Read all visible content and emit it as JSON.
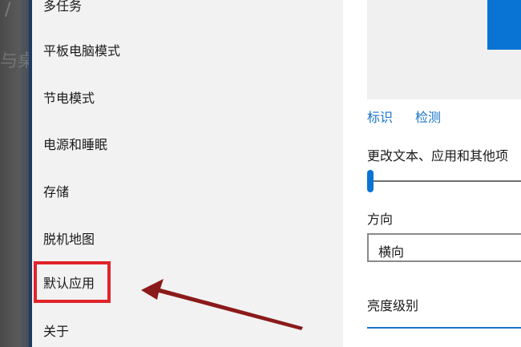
{
  "background": {
    "ghost_text": "与桌",
    "ghost_slash": "/"
  },
  "sidebar": {
    "items": [
      {
        "label": "多任务"
      },
      {
        "label": "平板电脑模式"
      },
      {
        "label": "节电模式"
      },
      {
        "label": "电源和睡眠"
      },
      {
        "label": "存储"
      },
      {
        "label": "脱机地图"
      },
      {
        "label": "默认应用",
        "highlighted": true
      },
      {
        "label": "关于"
      }
    ]
  },
  "main": {
    "identify_link": "标识",
    "detect_link": "检测",
    "scale_label": "更改文本、应用和其他项",
    "orientation_label": "方向",
    "orientation_value": "横向",
    "brightness_label": "亮度级别"
  },
  "colors": {
    "accent": "#0a74d4",
    "link": "#1a73c8",
    "highlight_box": "#e0242b",
    "arrow": "#8b1a1a"
  }
}
